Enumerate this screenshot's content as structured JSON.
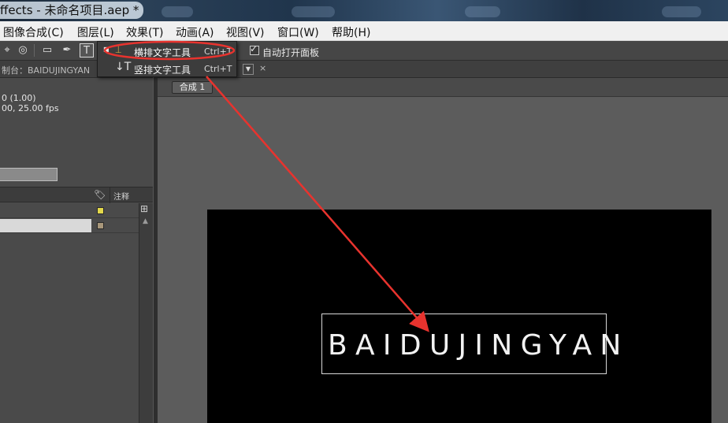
{
  "window": {
    "title": "ffects - 未命名项目.aep *"
  },
  "menubar": {
    "items": [
      "图像合成(C)",
      "图层(L)",
      "效果(T)",
      "动画(A)",
      "视图(V)",
      "窗口(W)",
      "帮助(H)"
    ]
  },
  "toolbar": {
    "text_tool_icon": "T",
    "auto_open_panel_checked": true,
    "auto_open_panel_label": "自动打开面板"
  },
  "dropdown": {
    "items": [
      {
        "label": "横排文字工具",
        "shortcut": "Ctrl+T",
        "icon": "horizontal-type-icon",
        "selected": true
      },
      {
        "label": "竖排文字工具",
        "shortcut": "Ctrl+T",
        "icon": "vertical-type-icon",
        "selected": false
      }
    ]
  },
  "left_panel": {
    "header": "制台：BAIDUJINGYAN",
    "info_line1": "0 (1.00)",
    "info_line2": "00, 25.00 fps",
    "col_note": "注释",
    "rows": [
      {
        "label_color": "#e3d84a",
        "selected": false
      },
      {
        "label_color": "#a8977a",
        "selected": true
      }
    ]
  },
  "composition": {
    "tab_chip": "合成 1",
    "text_layer": "BAIDUJINGYAN"
  },
  "colors": {
    "annotation_red": "#e8332e",
    "canvas": "#000000"
  }
}
